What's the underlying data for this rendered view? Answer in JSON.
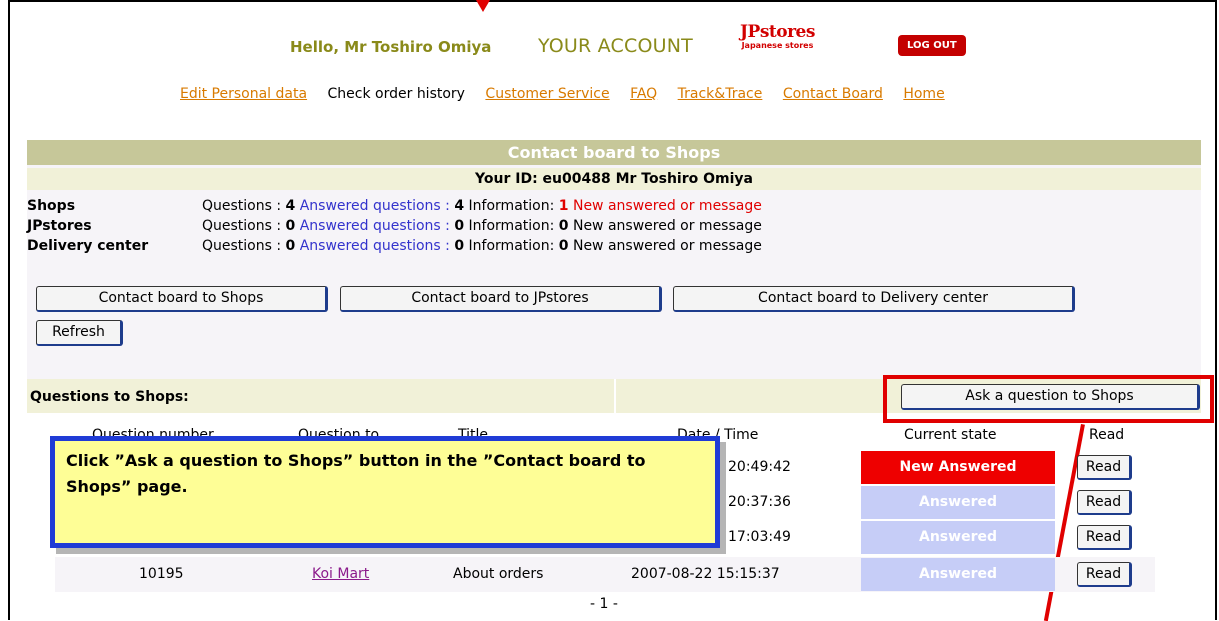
{
  "header": {
    "greeting": "Hello, Mr Toshiro Omiya",
    "account": "YOUR ACCOUNT",
    "logo_main": "JPstores",
    "logo_sub": "Japanese stores",
    "logout": "LOG OUT"
  },
  "nav": [
    {
      "label": "Edit Personal data",
      "link": true
    },
    {
      "label": "Check order history",
      "link": false
    },
    {
      "label": "Customer Service",
      "link": true
    },
    {
      "label": "FAQ",
      "link": true
    },
    {
      "label": "Track&Trace",
      "link": true
    },
    {
      "label": "Contact Board",
      "link": true
    },
    {
      "label": "Home",
      "link": true
    }
  ],
  "panel": {
    "title": "Contact board to Shops",
    "your_id": "Your ID: eu00488 Mr Toshiro Omiya",
    "stats": [
      {
        "label": "Shops",
        "questions": "4",
        "answered": "4",
        "information": "1",
        "info_highlight": true
      },
      {
        "label": "JPstores",
        "questions": "0",
        "answered": "0",
        "information": "0",
        "info_highlight": false
      },
      {
        "label": "Delivery center",
        "questions": "0",
        "answered": "0",
        "information": "0",
        "info_highlight": false
      }
    ],
    "stat_labels": {
      "questions": "Questions : ",
      "answered": "Answered questions : ",
      "information": "Information: ",
      "new": "New answered or message"
    },
    "buttons": {
      "shops": "Contact board to Shops",
      "jpstores": "Contact board to JPstores",
      "delivery": "Contact board to Delivery center",
      "refresh": "Refresh"
    }
  },
  "questions": {
    "heading": "Questions to Shops:",
    "ask_button": "Ask a question to Shops",
    "columns": [
      "Question number",
      "Question to",
      "Title",
      "Date / Time",
      "Current state",
      "Read"
    ],
    "rows": [
      {
        "time": "20:49:42",
        "state": "New Answered",
        "read": "Read"
      },
      {
        "time": "20:37:36",
        "state": "Answered",
        "read": "Read"
      },
      {
        "time": "17:03:49",
        "state": "Answered",
        "read": "Read"
      },
      {
        "number": "10195",
        "to": "Koi Mart",
        "title": "About orders",
        "datetime": "2007-08-22 15:15:37",
        "state": "Answered",
        "read": "Read"
      }
    ],
    "page": "- 1 -"
  },
  "callout": {
    "text": "Click ”Ask a question to Shops” button in the ”Contact board to Shops” page."
  },
  "colors": {
    "new_answered": "#ee0000",
    "answered": "#c6cdf7",
    "banner": "#c6c799",
    "highlight": "#e00000",
    "callout_bg": "#fefe96",
    "callout_border": "#1f3bd6"
  }
}
